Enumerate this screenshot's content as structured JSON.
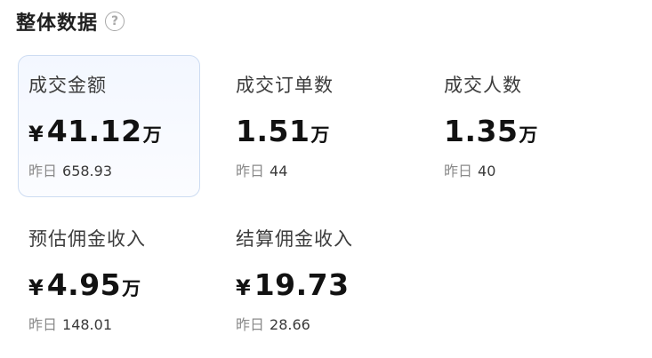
{
  "header": {
    "title": "整体数据",
    "help_icon": "?"
  },
  "metrics": [
    {
      "label": "成交金额",
      "currency": "¥",
      "value": "41.12",
      "unit": "万",
      "yesterday_label": "昨日",
      "yesterday_value": "658.93",
      "selected": true
    },
    {
      "label": "成交订单数",
      "currency": "",
      "value": "1.51",
      "unit": "万",
      "yesterday_label": "昨日",
      "yesterday_value": "44"
    },
    {
      "label": "成交人数",
      "currency": "",
      "value": "1.35",
      "unit": "万",
      "yesterday_label": "昨日",
      "yesterday_value": "40"
    },
    {
      "label": "预估佣金收入",
      "currency": "¥",
      "value": "4.95",
      "unit": "万",
      "yesterday_label": "昨日",
      "yesterday_value": "148.01"
    },
    {
      "label": "结算佣金收入",
      "currency": "¥",
      "value": "19.73",
      "unit": "",
      "yesterday_label": "昨日",
      "yesterday_value": "28.66"
    }
  ],
  "colors": {
    "selected_border": "#cddcf2",
    "selected_bg": "#f3f7ff",
    "text_primary": "#121212",
    "text_secondary": "#8a8a8a"
  }
}
